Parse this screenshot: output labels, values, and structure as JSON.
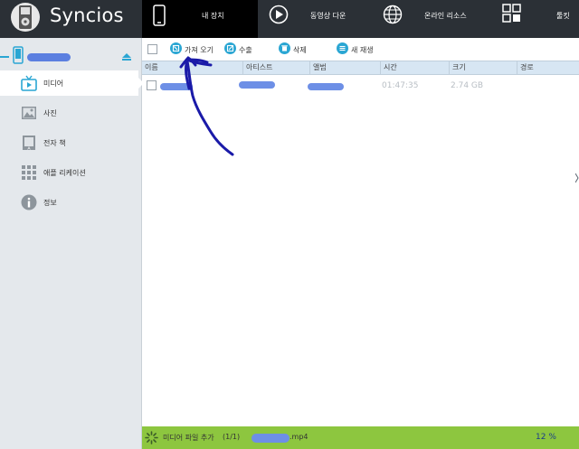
{
  "app": {
    "name": "Syncios",
    "accent": "#2aa6d3",
    "status_green": "#8dc63f",
    "topbar_bg": "#2b3036"
  },
  "tabs": [
    {
      "label": "내 장치",
      "icon": "phone-icon",
      "active": true
    },
    {
      "label": "동영상 다운",
      "icon": "play-icon",
      "active": false
    },
    {
      "label": "온라인 리소스",
      "icon": "globe-icon",
      "active": false
    },
    {
      "label": "툴킷",
      "icon": "grid-icon",
      "active": false
    }
  ],
  "sidebar": {
    "device_name": "",
    "items": [
      {
        "label": "미디어",
        "icon": "tv-icon",
        "active": true
      },
      {
        "label": "사진",
        "icon": "photo-icon",
        "active": false
      },
      {
        "label": "전자 책",
        "icon": "book-icon",
        "active": false
      },
      {
        "label": "애플 리케이션",
        "icon": "apps-grid-icon",
        "active": false
      },
      {
        "label": "정보",
        "icon": "info-icon",
        "active": false
      }
    ]
  },
  "toolbar": {
    "import_label": "가져 오기",
    "export_label": "수출",
    "delete_label": "삭제",
    "new_playlist_label": "새 재생"
  },
  "table": {
    "columns": [
      "이름",
      "아티스트",
      "앨범",
      "시간",
      "크기",
      "경로"
    ],
    "rows": [
      {
        "name": "",
        "artist": "",
        "album": "",
        "time": "01:47:35",
        "size": "2.74 GB",
        "path": ""
      }
    ]
  },
  "status": {
    "label": "미디어 파일 추가",
    "count": "(1/1)",
    "file_suffix": ".mp4",
    "progress_percent_text": "12 %",
    "progress_percent": 12
  }
}
